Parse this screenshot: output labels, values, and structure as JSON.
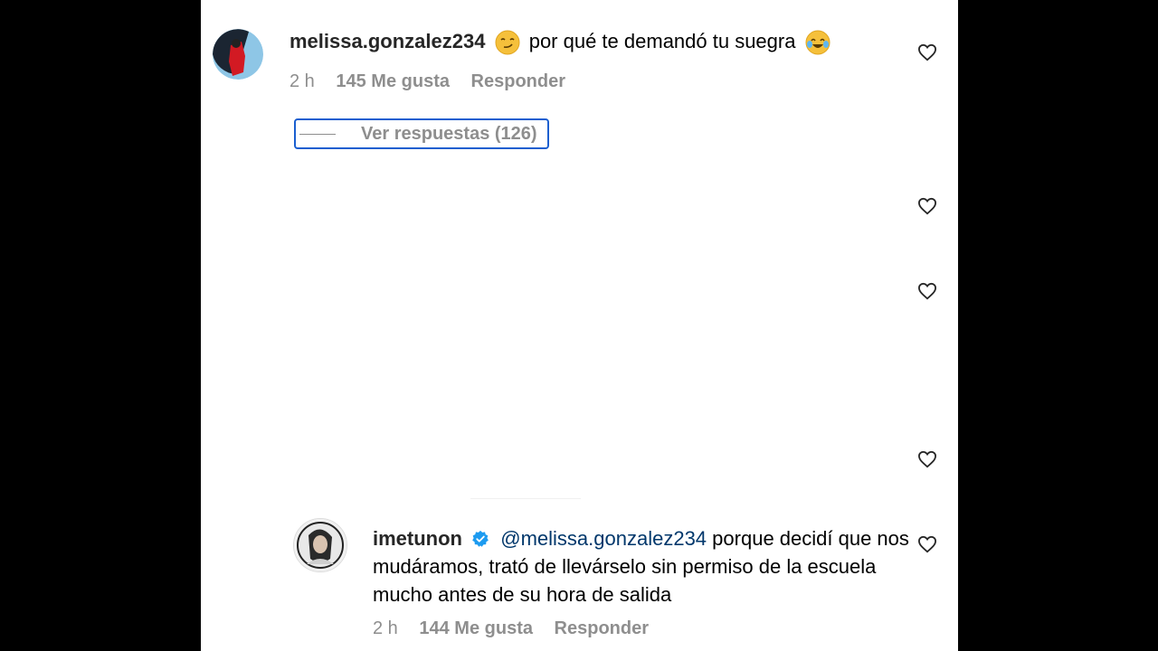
{
  "comments": [
    {
      "username": "melissa.gonzalez234",
      "text": "por qué te demandó tu suegra",
      "time": "2 h",
      "likes": "145 Me gusta",
      "reply_label": "Responder",
      "view_replies": "Ver respuestas (126)"
    },
    {
      "username": "imetunon",
      "mention": "@melissa.gonzalez234",
      "text": "porque decidí que nos mudáramos, trató de llevárselo sin permiso de la escuela mucho antes de su hora de salida",
      "time": "2 h",
      "likes": "144 Me gusta",
      "reply_label": "Responder"
    }
  ],
  "icons": {
    "emoji_1": "smirk-emoji",
    "emoji_2": "tears-of-joy-emoji",
    "like": "heart-outline-icon",
    "verified": "verified-badge-icon"
  },
  "colors": {
    "verified_blue": "#1d9bf0",
    "focus_outline": "#1a5fd0",
    "mention": "#00376b",
    "muted": "#8e8e8e"
  }
}
